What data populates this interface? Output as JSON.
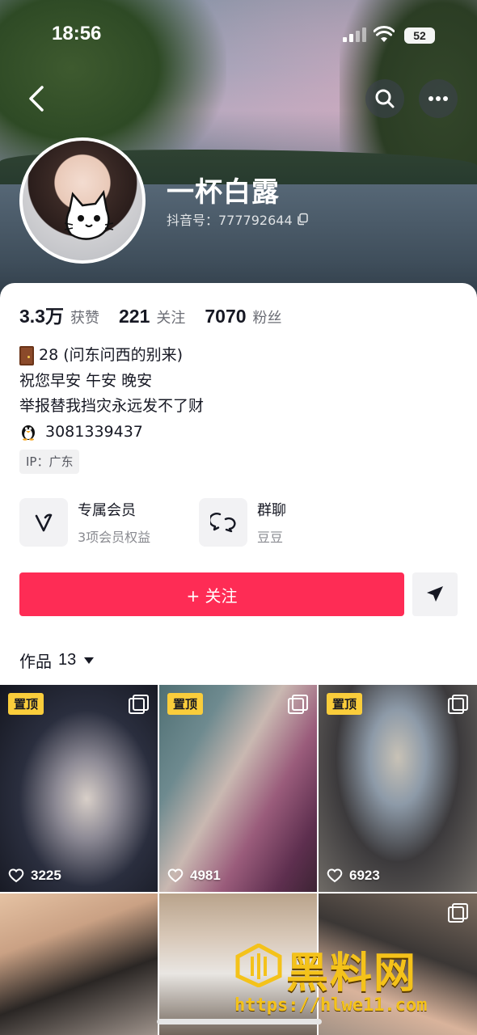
{
  "status_bar": {
    "time": "18:56",
    "battery": "52"
  },
  "profile": {
    "name": "一杯白露",
    "id_label": "抖音号：777792644"
  },
  "stats": [
    {
      "value": "3.3万",
      "label": "获赞"
    },
    {
      "value": "221",
      "label": "关注"
    },
    {
      "value": "7070",
      "label": "粉丝"
    }
  ],
  "bio": {
    "line1": "28 (问东问西的别来)",
    "line2": "祝您早安 午安 晚安",
    "line3": "举报替我挡灾永远发不了财",
    "line4": "3081339437"
  },
  "ip": "IP：广东",
  "features": [
    {
      "title": "专属会员",
      "subtitle": "3项会员权益",
      "icon": "vip-v-icon"
    },
    {
      "title": "群聊",
      "subtitle": "豆豆",
      "icon": "chat-bubbles-icon"
    }
  ],
  "follow_label": "+ 关注",
  "works": {
    "label": "作品",
    "count": "13"
  },
  "videos": [
    {
      "pinned": "置顶",
      "likes": "3225"
    },
    {
      "pinned": "置顶",
      "likes": "4981"
    },
    {
      "pinned": "置顶",
      "likes": "6923"
    },
    {
      "pinned": "",
      "likes": ""
    },
    {
      "pinned": "",
      "likes": ""
    },
    {
      "pinned": "",
      "likes": ""
    }
  ],
  "watermark": {
    "text": "黑料网",
    "url": "https://hlwe11.com"
  },
  "colors": {
    "accent": "#fe2c55",
    "pin": "#facd3b"
  }
}
